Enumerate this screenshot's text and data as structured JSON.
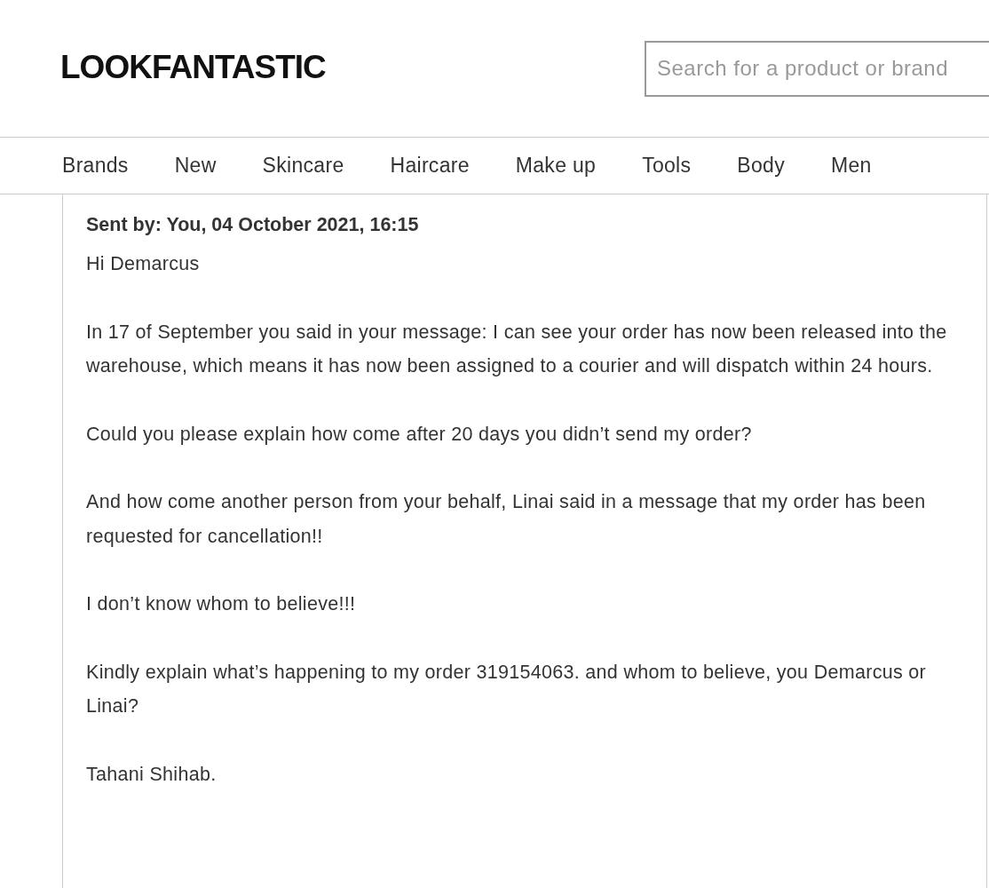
{
  "header": {
    "logo": "LOOKFANTASTIC",
    "search": {
      "placeholder": "Search for a product or brand"
    }
  },
  "nav": [
    "Brands",
    "New",
    "Skincare",
    "Haircare",
    "Make up",
    "Tools",
    "Body",
    "Men"
  ],
  "message": {
    "sent_by": "Sent by: You, 04 October 2021, 16:15",
    "paragraphs": [
      "Hi Demarcus",
      "In 17 of September you said in your message: I can see your order has now been released into the warehouse, which means it has now been assigned to a courier and will dispatch within 24 hours.",
      "Could you please explain how come after 20 days you didn’t send my order?",
      "And how come another person from your behalf, Linai said in a message that my order has been requested for cancellation!!",
      "I don’t know whom to believe!!!",
      "Kindly explain what’s happening to my order 319154063. and whom to believe, you Demarcus or Linai?",
      "Tahani Shihab."
    ]
  }
}
